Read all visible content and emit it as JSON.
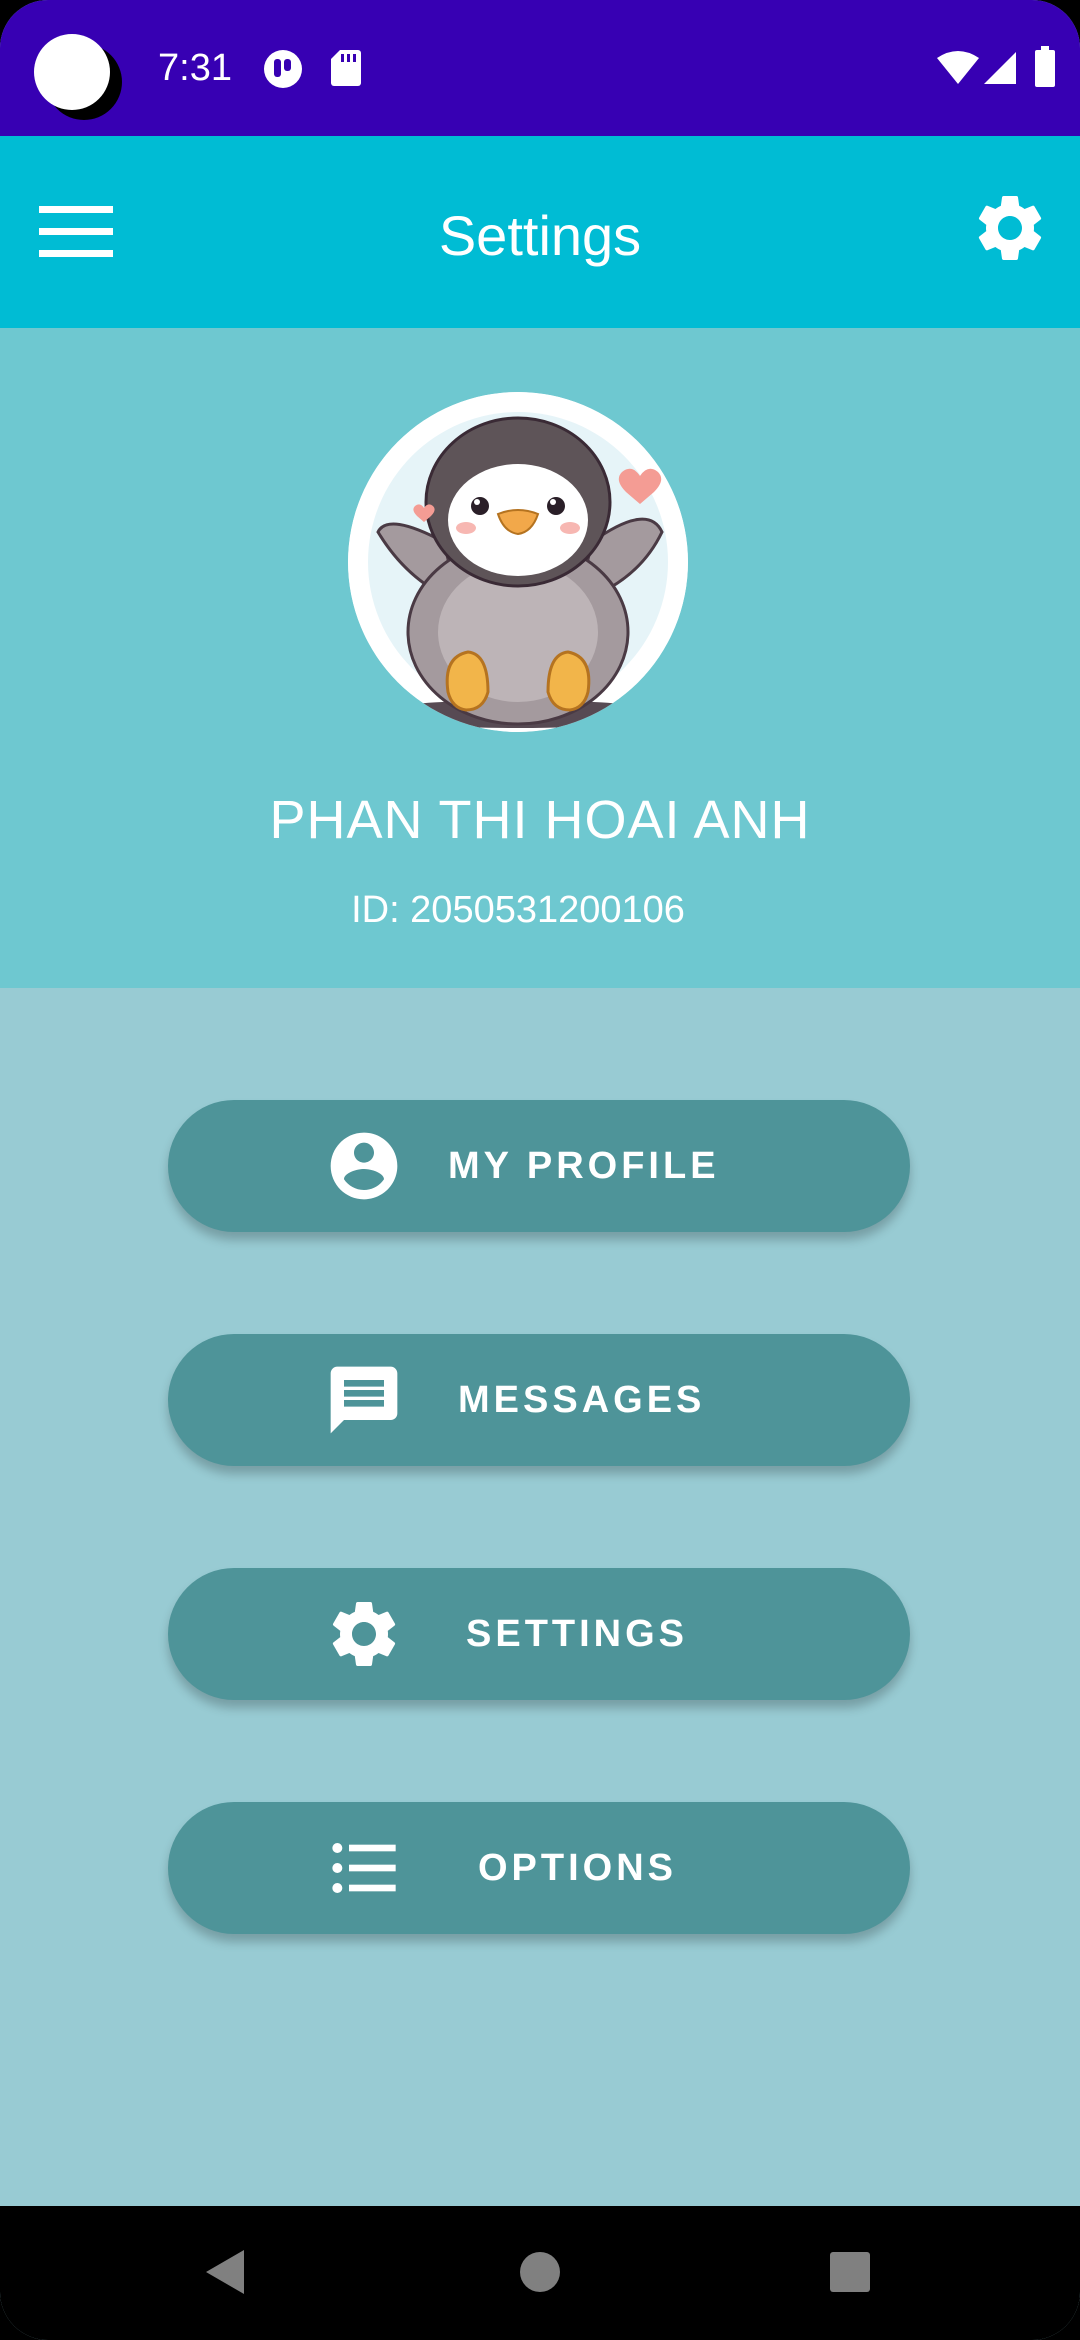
{
  "status_bar": {
    "time": "7:31",
    "icons": [
      "notification-app-icon",
      "sd-card-icon",
      "wifi-icon",
      "signal-icon",
      "battery-icon"
    ]
  },
  "app_bar": {
    "title": "Settings",
    "left_icon": "menu-icon",
    "right_icon": "gear-icon"
  },
  "profile": {
    "name": "PHAN THI HOAI ANH",
    "id_text": "ID: 2050531200106",
    "avatar": "penguin-avatar"
  },
  "menu": [
    {
      "label": "MY PROFILE",
      "icon": "account-circle-icon"
    },
    {
      "label": "MESSAGES",
      "icon": "message-icon"
    },
    {
      "label": "SETTINGS",
      "icon": "gear-icon"
    },
    {
      "label": "OPTIONS",
      "icon": "list-icon"
    }
  ],
  "nav_bar": {
    "icons": [
      "back-icon",
      "home-icon",
      "recents-icon"
    ]
  },
  "colors": {
    "status_bar": "#3700B3",
    "app_bar": "#00BCD4",
    "profile_header": "#6EC8D0",
    "body": "#98CBD3",
    "button": "#4E9499"
  }
}
